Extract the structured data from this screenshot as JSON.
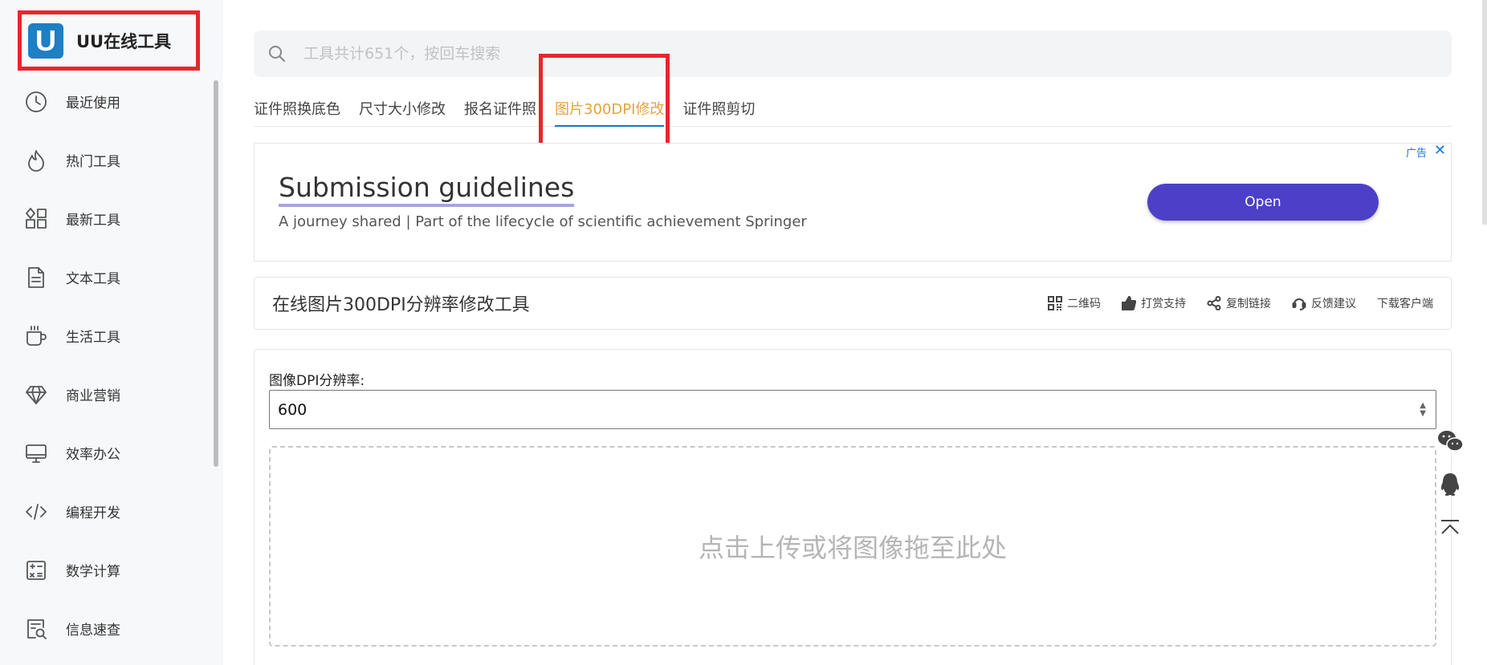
{
  "logo": {
    "badge": "U",
    "text": "UU在线工具"
  },
  "sidebar": {
    "items": [
      {
        "label": "最近使用",
        "icon": "clock-icon"
      },
      {
        "label": "热门工具",
        "icon": "flame-icon"
      },
      {
        "label": "最新工具",
        "icon": "grid-icon"
      },
      {
        "label": "文本工具",
        "icon": "document-icon"
      },
      {
        "label": "生活工具",
        "icon": "cup-icon"
      },
      {
        "label": "商业营销",
        "icon": "diamond-icon"
      },
      {
        "label": "效率办公",
        "icon": "monitor-icon"
      },
      {
        "label": "编程开发",
        "icon": "code-icon"
      },
      {
        "label": "数学计算",
        "icon": "calculator-icon"
      },
      {
        "label": "信息速查",
        "icon": "search-doc-icon"
      }
    ]
  },
  "search": {
    "placeholder": "工具共计651个，按回车搜索"
  },
  "tabs": [
    {
      "label": "证件照换底色"
    },
    {
      "label": "尺寸大小修改"
    },
    {
      "label": "报名证件照"
    },
    {
      "label": "图片300DPI修改",
      "active": true
    },
    {
      "label": "证件照剪切"
    }
  ],
  "ad": {
    "tag": "广告",
    "close": "✕",
    "title": "Submission guidelines",
    "subtitle": "A journey shared | Part of the lifecycle of scientific achievement Springer",
    "button": "Open"
  },
  "tool": {
    "title": "在线图片300DPI分辨率修改工具",
    "actions": [
      {
        "label": "二维码",
        "icon": "qrcode-icon"
      },
      {
        "label": "打赏支持",
        "icon": "thumbs-up-icon"
      },
      {
        "label": "复制链接",
        "icon": "share-icon"
      },
      {
        "label": "反馈建议",
        "icon": "feedback-icon"
      },
      {
        "label": "下载客户端"
      }
    ]
  },
  "form": {
    "dpi_label": "图像DPI分辨率:",
    "dpi_value": "600",
    "drop_text": "点击上传或将图像拖至此处"
  },
  "colors": {
    "accent": "#e6a23c",
    "highlight": "#e8262d",
    "ad_button": "#4c40c8",
    "brand": "#1d7fc4"
  }
}
